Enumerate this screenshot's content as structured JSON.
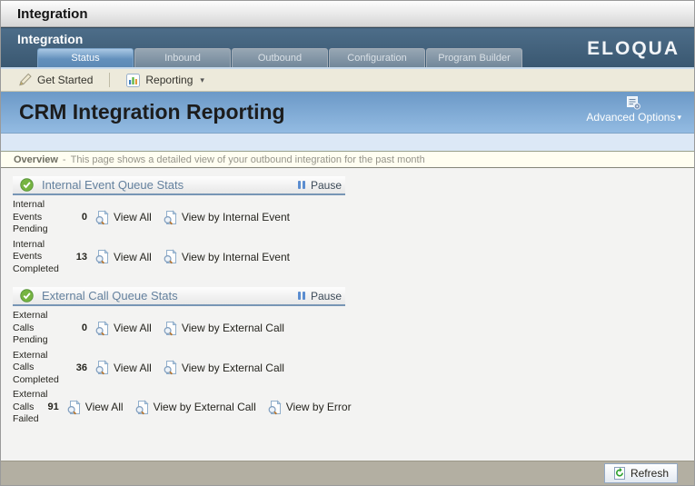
{
  "window": {
    "title": "Integration"
  },
  "nav": {
    "app_title": "Integration",
    "logo": "ELOQUA",
    "tabs": [
      {
        "label": "Status",
        "active": true
      },
      {
        "label": "Inbound",
        "active": false
      },
      {
        "label": "Outbound",
        "active": false
      },
      {
        "label": "Configuration",
        "active": false
      },
      {
        "label": "Program Builder",
        "active": false
      }
    ]
  },
  "toolbar": {
    "get_started": "Get Started",
    "reporting": "Reporting"
  },
  "banner": {
    "title": "CRM Integration Reporting",
    "advanced_options": "Advanced Options"
  },
  "overview": {
    "label": "Overview",
    "separator": "-",
    "description": "This page shows a detailed view of your outbound integration for the past month"
  },
  "sections": [
    {
      "title": "Internal Event Queue Stats",
      "pause_label": "Pause",
      "rows": [
        {
          "label": "Internal Events Pending",
          "value": "0",
          "links": [
            "View All",
            "View by Internal Event"
          ]
        },
        {
          "label": "Internal Events Completed",
          "value": "13",
          "links": [
            "View All",
            "View by Internal Event"
          ]
        }
      ]
    },
    {
      "title": "External Call Queue Stats",
      "pause_label": "Pause",
      "rows": [
        {
          "label": "External Calls Pending",
          "value": "0",
          "links": [
            "View All",
            "View by External Call"
          ]
        },
        {
          "label": "External Calls Completed",
          "value": "36",
          "links": [
            "View All",
            "View by External Call"
          ]
        },
        {
          "label": "External Calls Failed",
          "value": "91",
          "links": [
            "View All",
            "View by External Call",
            "View by Error"
          ]
        }
      ]
    }
  ],
  "footer": {
    "refresh_label": "Refresh"
  },
  "colors": {
    "nav_bar": "#3f5d78",
    "active_tab": "#6390bc",
    "banner_top": "#6c99c7",
    "banner_bottom": "#93bbe2",
    "toolbar_bg": "#edeadb",
    "overview_bg": "#fffef1",
    "status_ok_green": "#76b441",
    "pause_blue": "#5b8dd0",
    "footer_bg": "#b3afa2",
    "refresh_green": "#2ca02c"
  }
}
